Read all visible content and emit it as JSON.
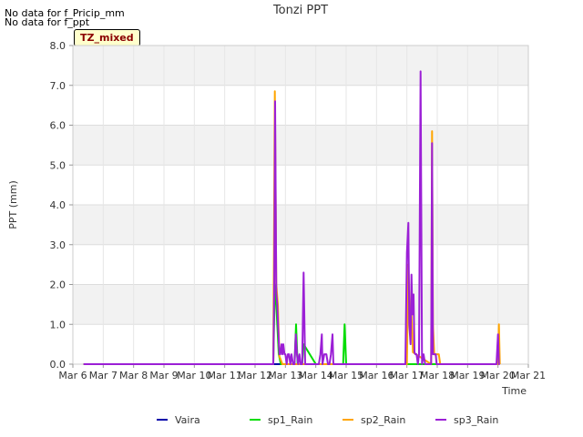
{
  "notes": [
    "No data for f_Pricip_mm",
    "No data for f_ppt"
  ],
  "tag": "TZ_mixed",
  "chart_data": {
    "type": "line",
    "title": "Tonzi PPT",
    "xlabel": "Time",
    "ylabel": "PPT (mm)",
    "ylim": [
      0,
      8
    ],
    "xlim": [
      0,
      15
    ],
    "x_ticks": [
      {
        "x": 0,
        "label": "Mar 6"
      },
      {
        "x": 1,
        "label": "Mar 7"
      },
      {
        "x": 2,
        "label": "Mar 8"
      },
      {
        "x": 3,
        "label": "Mar 9"
      },
      {
        "x": 4,
        "label": "Mar 10"
      },
      {
        "x": 5,
        "label": "Mar 11"
      },
      {
        "x": 6,
        "label": "Mar 12"
      },
      {
        "x": 7,
        "label": "Mar 13"
      },
      {
        "x": 8,
        "label": "Mar 14"
      },
      {
        "x": 9,
        "label": "Mar 15"
      },
      {
        "x": 10,
        "label": "Mar 16"
      },
      {
        "x": 11,
        "label": "Mar 17"
      },
      {
        "x": 12,
        "label": "Mar 18"
      },
      {
        "x": 13,
        "label": "Mar 19"
      },
      {
        "x": 14,
        "label": "Mar 20"
      },
      {
        "x": 15,
        "label": "Mar 21"
      }
    ],
    "y_ticks": [
      "0.0",
      "1.0",
      "2.0",
      "3.0",
      "4.0",
      "5.0",
      "6.0",
      "7.0",
      "8.0"
    ],
    "grid": true,
    "legend_position": "bottom",
    "series": [
      {
        "name": "Vaira",
        "color": "#0000aa",
        "x": [
          0.35,
          14.0
        ],
        "values": [
          0,
          0
        ]
      },
      {
        "name": "sp1_Rain",
        "color": "#00dd00",
        "x": [
          0.35,
          6.6,
          6.65,
          6.7,
          6.78,
          6.85,
          6.9,
          7.3,
          7.35,
          7.4,
          7.55,
          7.6,
          8.0,
          8.9,
          8.95,
          9.0,
          14.0
        ],
        "values": [
          0,
          0,
          2.0,
          1.5,
          0.25,
          0,
          0,
          0,
          1.0,
          0,
          0,
          0.5,
          0,
          0,
          1.0,
          0,
          0
        ]
      },
      {
        "name": "sp2_Rain",
        "color": "#ffa500",
        "x": [
          0.35,
          6.6,
          6.65,
          6.7,
          6.75,
          6.8,
          6.9,
          11.0,
          11.05,
          11.1,
          11.15,
          11.2,
          11.8,
          11.83,
          11.86,
          11.9,
          11.95,
          12.0,
          12.05,
          12.1,
          14.0,
          14.03,
          14.06
        ],
        "values": [
          0,
          0,
          6.85,
          2.0,
          1.5,
          0.2,
          0,
          0,
          2.5,
          1.0,
          1.25,
          0.3,
          0,
          5.85,
          1.0,
          0.25,
          0.25,
          0.25,
          0.25,
          0,
          0,
          1.0,
          0
        ]
      },
      {
        "name": "sp3_Rain",
        "color": "#9b1fd6",
        "x": [
          0.35,
          6.6,
          6.63,
          6.66,
          6.7,
          6.73,
          6.77,
          6.8,
          6.83,
          6.87,
          6.9,
          6.93,
          6.97,
          7.0,
          7.04,
          7.08,
          7.12,
          7.16,
          7.2,
          7.25,
          7.3,
          7.34,
          7.38,
          7.42,
          7.46,
          7.5,
          7.55,
          7.6,
          7.65,
          8.0,
          8.1,
          8.15,
          8.2,
          8.22,
          8.28,
          8.35,
          8.4,
          8.45,
          8.5,
          8.55,
          8.58,
          8.6,
          8.63,
          8.7,
          8.75,
          8.8,
          10.95,
          11.0,
          11.05,
          11.08,
          11.12,
          11.15,
          11.18,
          11.22,
          11.25,
          11.28,
          11.32,
          11.36,
          11.4,
          11.45,
          11.5,
          11.55,
          11.6,
          11.7,
          11.75,
          11.8,
          11.83,
          11.86,
          11.89,
          11.92,
          11.95,
          11.98,
          12.0,
          12.02,
          12.05,
          13.95,
          14.0,
          14.03,
          14.06
        ],
        "values": [
          0,
          0,
          1.8,
          6.6,
          1.8,
          1.5,
          0.75,
          0.25,
          0.25,
          0.5,
          0.25,
          0.5,
          0.25,
          0.25,
          0,
          0.25,
          0.25,
          0,
          0.25,
          0,
          0,
          0.75,
          0.25,
          0,
          0.25,
          0,
          0,
          2.3,
          0,
          0,
          0,
          0.25,
          0.75,
          0,
          0.25,
          0.25,
          0,
          0,
          0.25,
          0.75,
          0,
          0,
          0,
          0,
          0,
          0,
          0,
          2.8,
          3.55,
          1.0,
          0.5,
          2.25,
          1.25,
          1.75,
          0.3,
          0.25,
          0.25,
          0,
          0.25,
          7.35,
          0,
          0.25,
          0,
          0,
          0,
          0,
          5.55,
          0.25,
          0.25,
          0.25,
          0.25,
          0,
          0,
          0,
          0,
          0,
          0.75,
          0,
          0
        ]
      }
    ]
  }
}
